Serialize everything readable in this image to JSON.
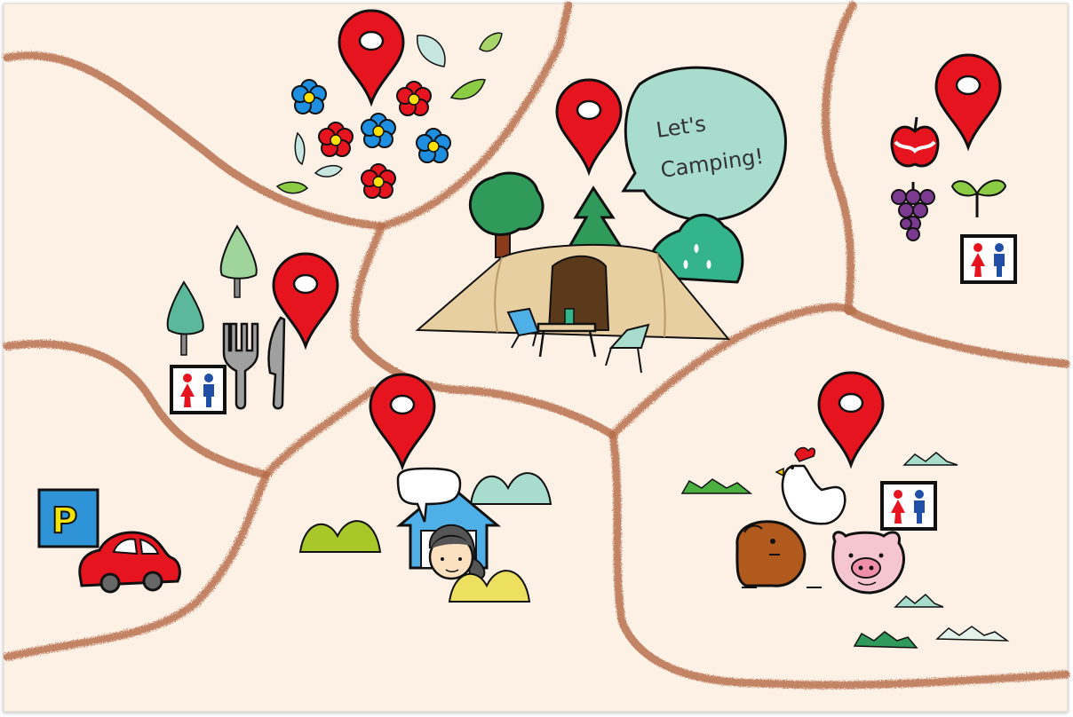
{
  "map": {
    "colors": {
      "background": "#fdf1e6",
      "road": "#b8714f",
      "pin": "#e6141e",
      "restroom_female": "#e6141e",
      "restroom_male": "#1f4fa6",
      "bubble": "#a8dccd",
      "tent": "#e8cfa2",
      "parking": "#2f93d8",
      "car": "#e6141e"
    },
    "speech_bubble": {
      "line1": "Let's",
      "line2": "Camping!"
    },
    "parking_sign": {
      "letter": "P"
    },
    "pins": [
      {
        "id": "flower-garden",
        "icon": "map-pin-icon"
      },
      {
        "id": "campsite",
        "icon": "map-pin-icon"
      },
      {
        "id": "fruit-picking",
        "icon": "map-pin-icon"
      },
      {
        "id": "restaurant",
        "icon": "map-pin-icon"
      },
      {
        "id": "reception",
        "icon": "map-pin-icon"
      },
      {
        "id": "animal-farm",
        "icon": "map-pin-icon"
      }
    ],
    "areas": [
      {
        "id": "flower-garden",
        "icons": [
          "flower-icon",
          "leaf-icon"
        ]
      },
      {
        "id": "campsite",
        "icons": [
          "tent-icon",
          "tree-icon",
          "bush-icon",
          "chair-icon",
          "table-icon",
          "lantern-icon"
        ]
      },
      {
        "id": "fruit-picking",
        "icons": [
          "apple-icon",
          "grape-icon",
          "sprout-icon",
          "restroom-icon"
        ]
      },
      {
        "id": "restaurant",
        "icons": [
          "tree-icon",
          "fork-icon",
          "knife-icon",
          "restroom-icon"
        ]
      },
      {
        "id": "parking",
        "icons": [
          "parking-sign-icon",
          "car-icon"
        ]
      },
      {
        "id": "reception",
        "icons": [
          "house-icon",
          "person-icon",
          "bush-icon"
        ]
      },
      {
        "id": "animal-farm",
        "icons": [
          "chicken-icon",
          "capybara-icon",
          "pig-icon",
          "grass-icon",
          "restroom-icon"
        ]
      }
    ]
  }
}
